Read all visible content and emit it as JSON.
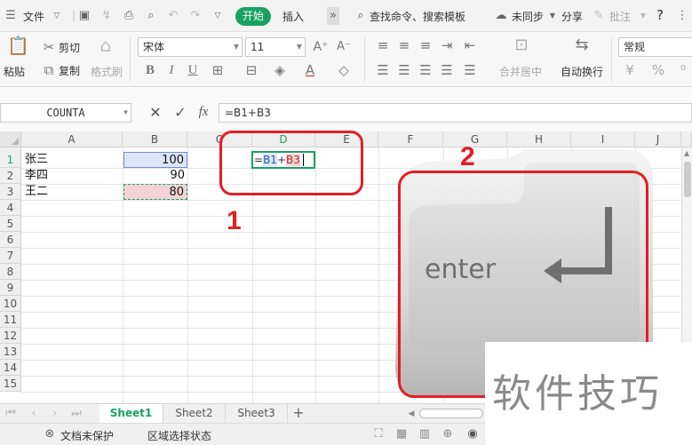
{
  "menubar": {
    "file_label": "文件",
    "active_tab": "开始",
    "insert_tab": "插入",
    "search_placeholder": "查找命令、搜索模板",
    "sync_label": "未同步",
    "share_label": "分享",
    "comment_label": "批注",
    "help_label": "?"
  },
  "ribbon": {
    "paste_label": "粘贴",
    "cut_label": "剪切",
    "copy_label": "复制",
    "format_painter_label": "格式刷",
    "font_name": "宋体",
    "font_size": "11",
    "bold": "B",
    "italic": "I",
    "underline": "U",
    "merge_center_label": "合并居中",
    "wrap_text_label": "自动换行",
    "number_format": "常规"
  },
  "formula_bar": {
    "name_box": "COUNTA",
    "fx_label": "fx",
    "formula": "=B1+B3"
  },
  "sheet": {
    "columns": [
      "A",
      "B",
      "C",
      "D",
      "E",
      "F",
      "G",
      "H",
      "I",
      "J"
    ],
    "rows": [
      "1",
      "2",
      "3",
      "4",
      "5",
      "6",
      "7",
      "8",
      "9",
      "10",
      "11",
      "12",
      "13",
      "14",
      "15"
    ],
    "cells": {
      "A1": "张三",
      "B1": "100",
      "A2": "李四",
      "B2": "90",
      "A3": "王二",
      "B3": "80"
    },
    "edit_cell": {
      "eq": "=",
      "ref1": "B1",
      "plus": "+",
      "ref2": "B3"
    }
  },
  "sheet_tabs": [
    "Sheet1",
    "Sheet2",
    "Sheet3"
  ],
  "add_sheet": "+",
  "status": {
    "protect_label": "文档未保护",
    "selection_label": "区域选择状态"
  },
  "annotations": {
    "step1": "1",
    "step2": "2",
    "key_text": "enter"
  },
  "watermark": "软件技巧",
  "colors": {
    "accent": "#19a25f",
    "annotation_red": "#e31e24",
    "ref1_fill": "#dce6f7",
    "ref2_fill": "#f3d3d3"
  }
}
